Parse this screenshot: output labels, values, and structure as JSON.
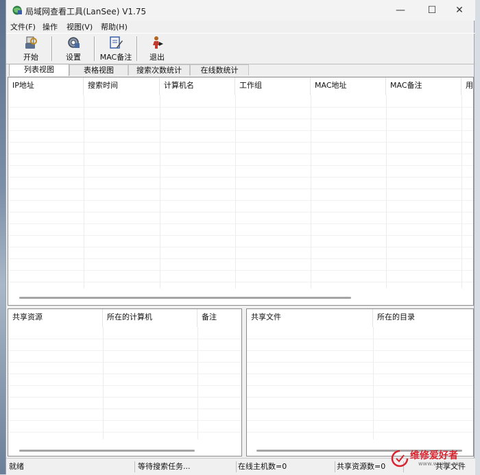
{
  "window": {
    "title": "局域网查看工具(LanSee) V1.75",
    "minimize": "—",
    "maximize": "☐",
    "close": "✕"
  },
  "menu": [
    "文件(F)",
    "操作",
    "视图(V)",
    "帮助(H)"
  ],
  "toolbar": {
    "start": "开始",
    "settings": "设置",
    "mac_note": "MAC备注",
    "exit": "退出"
  },
  "tabs": [
    "列表视图",
    "表格视图",
    "搜索次数统计",
    "在线数统计"
  ],
  "main_table": {
    "columns": [
      "IP地址",
      "搜索时间",
      "计算机名",
      "工作组",
      "MAC地址",
      "MAC备注",
      "用"
    ]
  },
  "share_table": {
    "columns": [
      "共享资源",
      "所在的计算机",
      "备注"
    ]
  },
  "file_table": {
    "columns": [
      "共享文件",
      "所在的目录"
    ]
  },
  "status": {
    "ready": "就绪",
    "waiting": "等待搜索任务...",
    "online_hosts": "在线主机数=0",
    "shared_count": "共享资源数=0",
    "shared_files": "共享文件"
  },
  "watermark": {
    "brand": "维修爱好者",
    "sub": "www.wxahz.com"
  },
  "colors": {
    "accent_red": "#d9232e"
  }
}
